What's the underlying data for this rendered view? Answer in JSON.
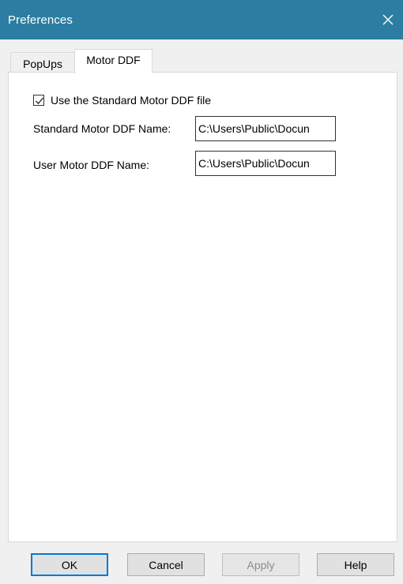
{
  "window": {
    "title": "Preferences",
    "close_icon": "close-icon",
    "titlebar_color": "#2b7ea1"
  },
  "tabs": [
    {
      "label": "PopUps",
      "selected": false
    },
    {
      "label": "Motor DDF",
      "selected": true
    }
  ],
  "motor_ddf": {
    "use_standard": {
      "label": "Use the Standard Motor DDF file",
      "checked": true
    },
    "standard_name": {
      "label": "Standard Motor DDF Name:",
      "value": "C:\\Users\\Public\\Docun"
    },
    "user_name": {
      "label": "User Motor DDF Name:",
      "value": "C:\\Users\\Public\\Docun"
    }
  },
  "buttons": {
    "ok": "OK",
    "cancel": "Cancel",
    "apply": "Apply",
    "help": "Help"
  }
}
